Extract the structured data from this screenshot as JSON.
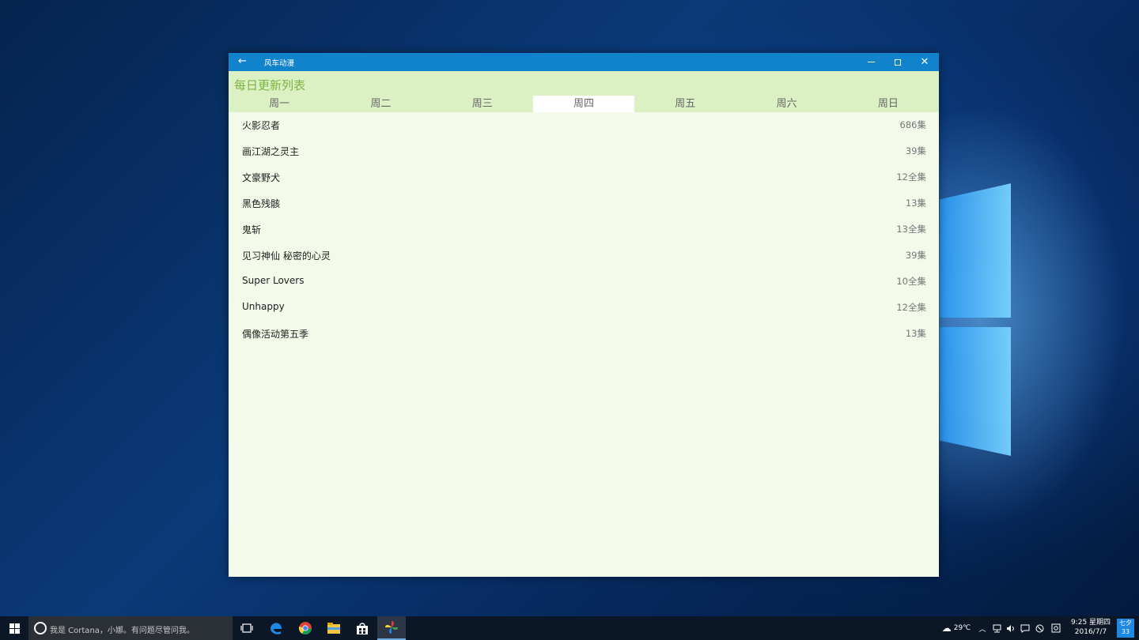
{
  "window": {
    "app_title": "风车动漫",
    "back_symbol": "←",
    "close_symbol": "✕"
  },
  "page": {
    "title": "每日更新列表",
    "tabs": [
      {
        "label": "周一"
      },
      {
        "label": "周二"
      },
      {
        "label": "周三"
      },
      {
        "label": "周四",
        "selected": true
      },
      {
        "label": "周五"
      },
      {
        "label": "周六"
      },
      {
        "label": "周日"
      }
    ]
  },
  "list": {
    "items": [
      {
        "name": "火影忍者",
        "episodes": "686集"
      },
      {
        "name": "画江湖之灵主",
        "episodes": "39集"
      },
      {
        "name": "文豪野犬",
        "episodes": "12全集"
      },
      {
        "name": "黑色残骸",
        "episodes": "13集"
      },
      {
        "name": "鬼斩",
        "episodes": "13全集"
      },
      {
        "name": "见习神仙 秘密的心灵",
        "episodes": "39集"
      },
      {
        "name": "Super Lovers",
        "episodes": "10全集"
      },
      {
        "name": "Unhappy",
        "episodes": "12全集"
      },
      {
        "name": "偶像活动第五季",
        "episodes": "13集"
      }
    ]
  },
  "taskbar": {
    "search_placeholder": "我是 Cortana，小娜。有问题尽管问我。",
    "temperature": "29℃",
    "time": "9:25 星期四",
    "date": "2016/7/7",
    "notification_line1": "七夕",
    "notification_line2": "33"
  },
  "colors": {
    "titlebar": "#1183cc",
    "header_band": "#dcf1c3",
    "title_text": "#7cb342",
    "content_bg": "#f3faea"
  },
  "icons": [
    "windows-logo-icon",
    "cortana-icon",
    "task-view-icon",
    "edge-icon",
    "chrome-icon",
    "file-explorer-icon",
    "store-icon",
    "pinwheel-app-icon",
    "weather-icon",
    "chevron-up-icon",
    "network-icon",
    "volume-icon",
    "action-center-icon",
    "ime-icon"
  ]
}
